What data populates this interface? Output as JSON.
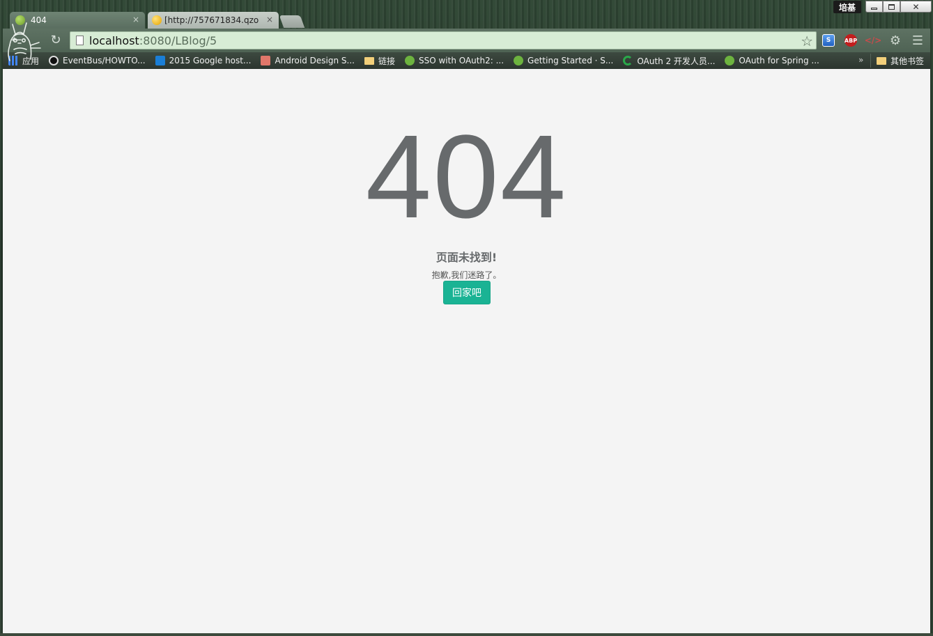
{
  "window": {
    "user_badge": "培基"
  },
  "tabs": [
    {
      "title": "404",
      "close": "×"
    },
    {
      "title": "[http://757671834.qzon",
      "close": "×"
    }
  ],
  "toolbar": {
    "back_glyph": "←",
    "reload_glyph": "↻",
    "url_host": "localhost",
    "url_rest": ":8080/LBlog/5",
    "star_glyph": "☆",
    "abp_label": "ABP",
    "code_glyph": "</>",
    "gear_glyph": "⚙",
    "menu_glyph": "☰"
  },
  "bookmarks": {
    "items": [
      {
        "label": "应用",
        "icon": "apps-icon"
      },
      {
        "label": "EventBus/HOWTO...",
        "icon": "github-icon"
      },
      {
        "label": "2015 Google host...",
        "icon": "l-icon"
      },
      {
        "label": "Android Design S...",
        "icon": "jian-icon"
      },
      {
        "label": "链接",
        "icon": "folder-icon"
      },
      {
        "label": "SSO with OAuth2: ...",
        "icon": "spring-icon"
      },
      {
        "label": "Getting Started · S...",
        "icon": "spring-icon"
      },
      {
        "label": "OAuth 2 开发人员...",
        "icon": "c-icon"
      },
      {
        "label": "OAuth for Spring ...",
        "icon": "spring-icon"
      }
    ],
    "more": "»",
    "other": "其他书签"
  },
  "page": {
    "code": "404",
    "title": "页面未找到!",
    "description": "抱歉,我们迷路了。",
    "home_button": "回家吧"
  },
  "colors": {
    "accent": "#1ab394",
    "text": "#676a6c",
    "background": "#f4f4f4"
  }
}
